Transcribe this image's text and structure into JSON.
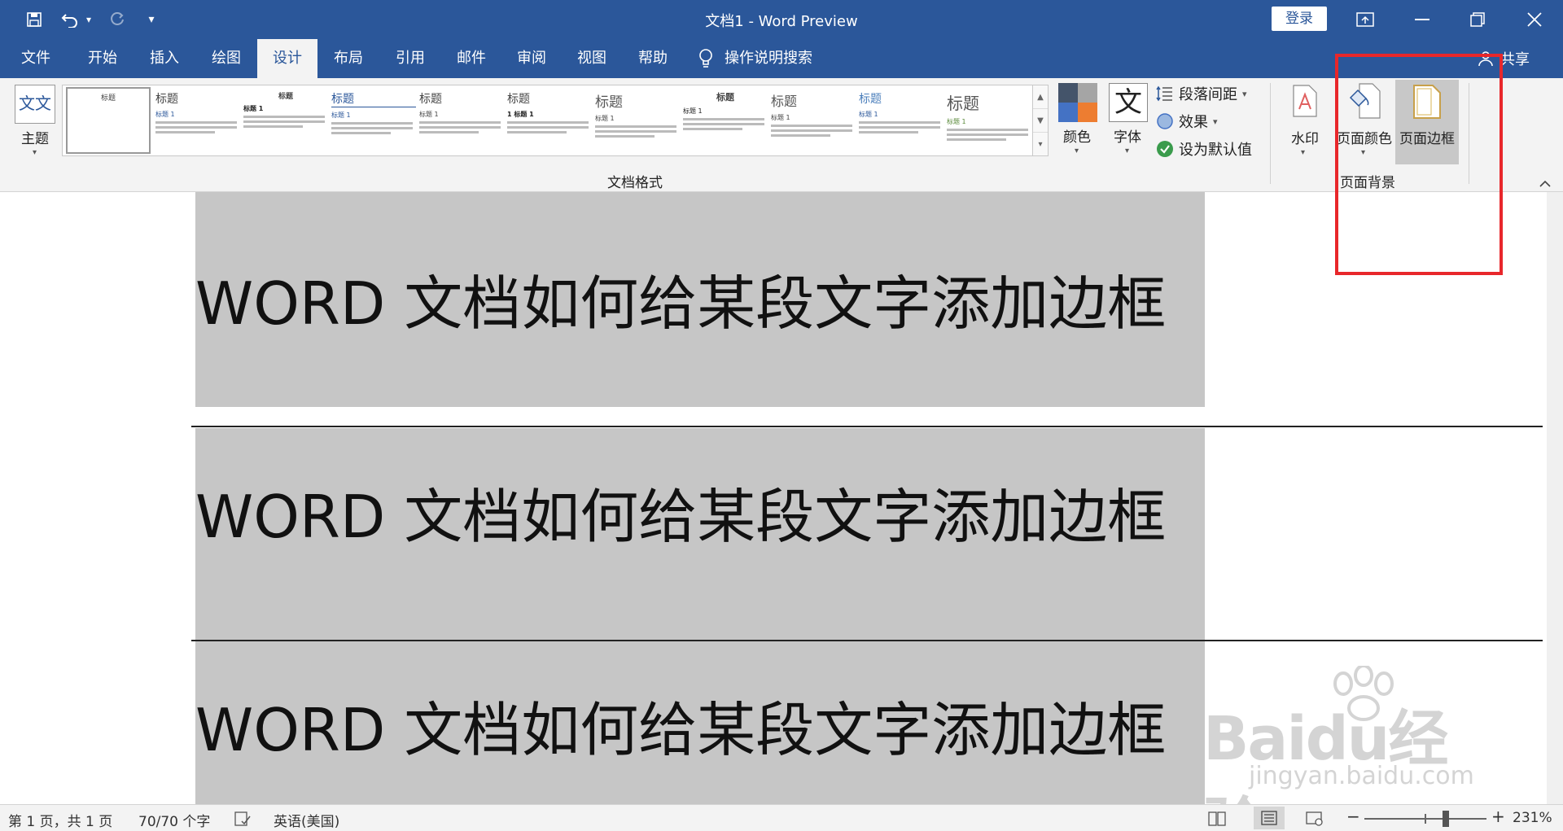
{
  "window": {
    "title": "文档1  -  Word Preview",
    "login_label": "登录",
    "share_label": "共享",
    "qa_more": "▾"
  },
  "tabs": [
    {
      "label": "文件"
    },
    {
      "label": "开始"
    },
    {
      "label": "插入"
    },
    {
      "label": "绘图"
    },
    {
      "label": "设计"
    },
    {
      "label": "布局"
    },
    {
      "label": "引用"
    },
    {
      "label": "邮件"
    },
    {
      "label": "审阅"
    },
    {
      "label": "视图"
    },
    {
      "label": "帮助"
    }
  ],
  "search_label": "操作说明搜索",
  "ribbon": {
    "theme_label": "主题",
    "theme_glyph": "文文",
    "gallery_group_label": "文档格式",
    "gallery": [
      {
        "heading": "标题",
        "sub": ""
      },
      {
        "heading": "标题",
        "sub": "标题 1"
      },
      {
        "heading": "标题",
        "sub": "标题 1"
      },
      {
        "heading": "标题",
        "sub": "标题 1"
      },
      {
        "heading": "标题",
        "sub": "标题 1"
      },
      {
        "heading": "标题",
        "sub": "1  标题 1"
      },
      {
        "heading": "标题",
        "sub": "标题 1"
      },
      {
        "heading": "标题",
        "sub": "标题 1"
      },
      {
        "heading": "标题",
        "sub": "标题 1"
      },
      {
        "heading": "标题",
        "sub": "标题 1"
      },
      {
        "heading": "标题",
        "sub": "标题 1"
      }
    ],
    "colors_label": "颜色",
    "fonts_label": "字体",
    "fonts_glyph": "文",
    "paragraph_spacing_label": "段落间距",
    "effects_label": "效果",
    "set_default_label": "设为默认值",
    "watermark_label": "水印",
    "page_color_label": "页面颜色",
    "page_borders_label": "页面边框",
    "page_background_group_label": "页面背景"
  },
  "document": {
    "paragraphs": [
      {
        "text": "WORD 文档如何给某段文字添加边框"
      },
      {
        "text": "WORD 文档如何给某段文字添加边框"
      },
      {
        "text": "WORD 文档如何给某段文字添加边框"
      }
    ]
  },
  "watermark": {
    "brand": "Baidu经验",
    "url": "jingyan.baidu.com"
  },
  "status": {
    "page": "第 1 页，共 1 页",
    "words": "70/70 个字",
    "language": "英语(美国)",
    "zoom": "231%",
    "zoom_minus": "−",
    "zoom_plus": "+"
  },
  "colors": {
    "accent": "#2b579a",
    "highlight": "#e8272b",
    "paragraph_shading": "#c6c6c6"
  }
}
